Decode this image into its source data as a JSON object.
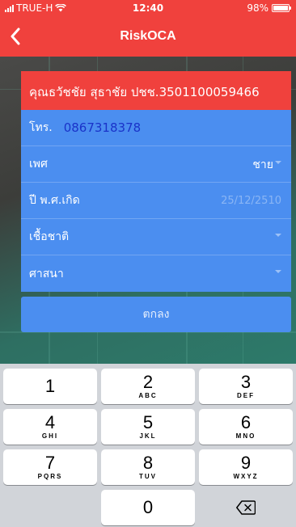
{
  "status_bar": {
    "carrier": "TRUE-H",
    "time": "12:40",
    "battery": "98%",
    "battery_level": 0.98
  },
  "nav": {
    "title": "RiskOCA",
    "back_icon": "chevron-left-icon"
  },
  "form": {
    "header": "คุณธวัชชัย สุธาชัย ปชช.3501100059466",
    "phone": {
      "label": "โทร.",
      "value": "0867318378"
    },
    "gender": {
      "label": "เพศ",
      "value": "ชาย"
    },
    "birth_year": {
      "label": "ปี พ.ศ.เกิด",
      "placeholder": "25/12/2510"
    },
    "nationality": {
      "label": "เชื้อชาติ",
      "value": ""
    },
    "religion": {
      "label": "ศาสนา",
      "value": ""
    },
    "ok_label": "ตกลง"
  },
  "keypad": {
    "keys": [
      {
        "num": "1",
        "letters": ""
      },
      {
        "num": "2",
        "letters": "ABC"
      },
      {
        "num": "3",
        "letters": "DEF"
      },
      {
        "num": "4",
        "letters": "GHI"
      },
      {
        "num": "5",
        "letters": "JKL"
      },
      {
        "num": "6",
        "letters": "MNO"
      },
      {
        "num": "7",
        "letters": "PQRS"
      },
      {
        "num": "8",
        "letters": "TUV"
      },
      {
        "num": "9",
        "letters": "WXYZ"
      },
      {
        "num": "0",
        "letters": ""
      }
    ],
    "delete_icon": "backspace-icon"
  },
  "colors": {
    "accent_red": "#f0413d",
    "form_blue": "#4b8ef0",
    "phone_text": "#1a33c9"
  }
}
